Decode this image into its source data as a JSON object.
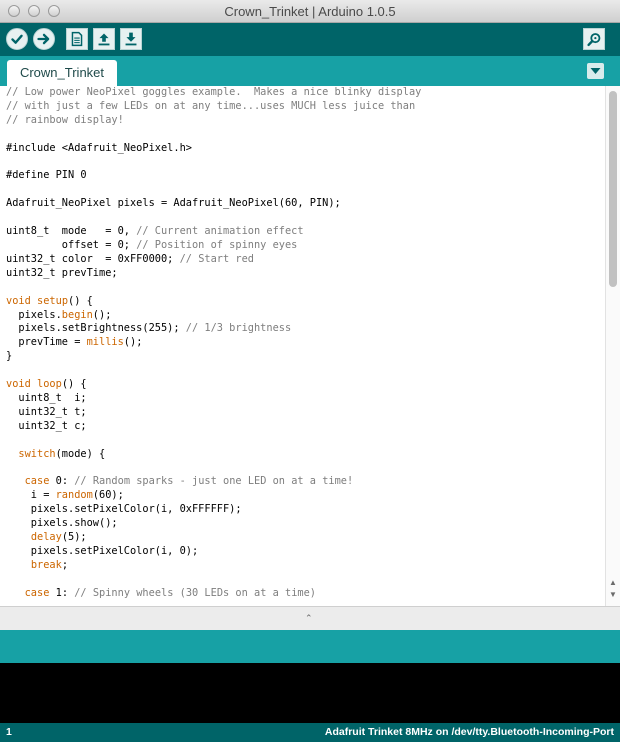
{
  "window": {
    "title": "Crown_Trinket | Arduino 1.0.5"
  },
  "toolbar": {
    "buttons": [
      "verify-icon",
      "upload-icon",
      "new-icon",
      "open-icon",
      "save-icon",
      "serial-monitor-icon"
    ]
  },
  "tabs": [
    {
      "label": "Crown_Trinket"
    }
  ],
  "editor": {
    "lines": [
      [
        {
          "t": "// Low power NeoPixel goggles example.  Makes a nice blinky display",
          "c": "cmt"
        }
      ],
      [
        {
          "t": "// with just a few LEDs on at any time...uses MUCH less juice than",
          "c": "cmt"
        }
      ],
      [
        {
          "t": "// rainbow display!",
          "c": "cmt"
        }
      ],
      [],
      [
        {
          "t": "#include <Adafruit_NeoPixel.h>"
        }
      ],
      [],
      [
        {
          "t": "#define PIN 0"
        }
      ],
      [],
      [
        {
          "t": "Adafruit_NeoPixel pixels = Adafruit_NeoPixel(60, PIN);"
        }
      ],
      [],
      [
        {
          "t": "uint8_t  mode   = 0, "
        },
        {
          "t": "// Current animation effect",
          "c": "cmt"
        }
      ],
      [
        {
          "t": "         offset = 0; "
        },
        {
          "t": "// Position of spinny eyes",
          "c": "cmt"
        }
      ],
      [
        {
          "t": "uint32_t color  = 0xFF0000; "
        },
        {
          "t": "// Start red",
          "c": "cmt"
        }
      ],
      [
        {
          "t": "uint32_t prevTime;"
        }
      ],
      [],
      [
        {
          "t": "void",
          "c": "kw"
        },
        {
          "t": " "
        },
        {
          "t": "setup",
          "c": "fn"
        },
        {
          "t": "() {"
        }
      ],
      [
        {
          "t": "  pixels."
        },
        {
          "t": "begin",
          "c": "fn"
        },
        {
          "t": "();"
        }
      ],
      [
        {
          "t": "  pixels.setBrightness(255); "
        },
        {
          "t": "// 1/3 brightness",
          "c": "cmt"
        }
      ],
      [
        {
          "t": "  prevTime = "
        },
        {
          "t": "millis",
          "c": "fn"
        },
        {
          "t": "();"
        }
      ],
      [
        {
          "t": "}"
        }
      ],
      [],
      [
        {
          "t": "void",
          "c": "kw"
        },
        {
          "t": " "
        },
        {
          "t": "loop",
          "c": "fn"
        },
        {
          "t": "() {"
        }
      ],
      [
        {
          "t": "  uint8_t  i;"
        }
      ],
      [
        {
          "t": "  uint32_t t;"
        }
      ],
      [
        {
          "t": "  uint32_t c;"
        }
      ],
      [],
      [
        {
          "t": "  "
        },
        {
          "t": "switch",
          "c": "kw"
        },
        {
          "t": "(mode) {"
        }
      ],
      [],
      [
        {
          "t": "   "
        },
        {
          "t": "case",
          "c": "kw"
        },
        {
          "t": " 0: "
        },
        {
          "t": "// Random sparks - just one LED on at a time!",
          "c": "cmt"
        }
      ],
      [
        {
          "t": "    i = "
        },
        {
          "t": "random",
          "c": "fn"
        },
        {
          "t": "(60);"
        }
      ],
      [
        {
          "t": "    pixels.setPixelColor(i, 0xFFFFFF);"
        }
      ],
      [
        {
          "t": "    pixels.show();"
        }
      ],
      [
        {
          "t": "    "
        },
        {
          "t": "delay",
          "c": "fn"
        },
        {
          "t": "(5);"
        }
      ],
      [
        {
          "t": "    pixels.setPixelColor(i, 0);"
        }
      ],
      [
        {
          "t": "    "
        },
        {
          "t": "break",
          "c": "kw"
        },
        {
          "t": ";"
        }
      ],
      [],
      [
        {
          "t": "   "
        },
        {
          "t": "case",
          "c": "kw"
        },
        {
          "t": " 1: "
        },
        {
          "t": "// Spinny wheels (30 LEDs on at a time)",
          "c": "cmt"
        }
      ]
    ]
  },
  "status": {
    "line_number": "1",
    "board": "Adafruit Trinket 8MHz on /dev/tty.Bluetooth-Incoming-Port"
  },
  "colors": {
    "toolbar": "#006468",
    "tabbar": "#17a1a5",
    "keyword": "#cc6600",
    "comment": "#7e7e7e"
  }
}
